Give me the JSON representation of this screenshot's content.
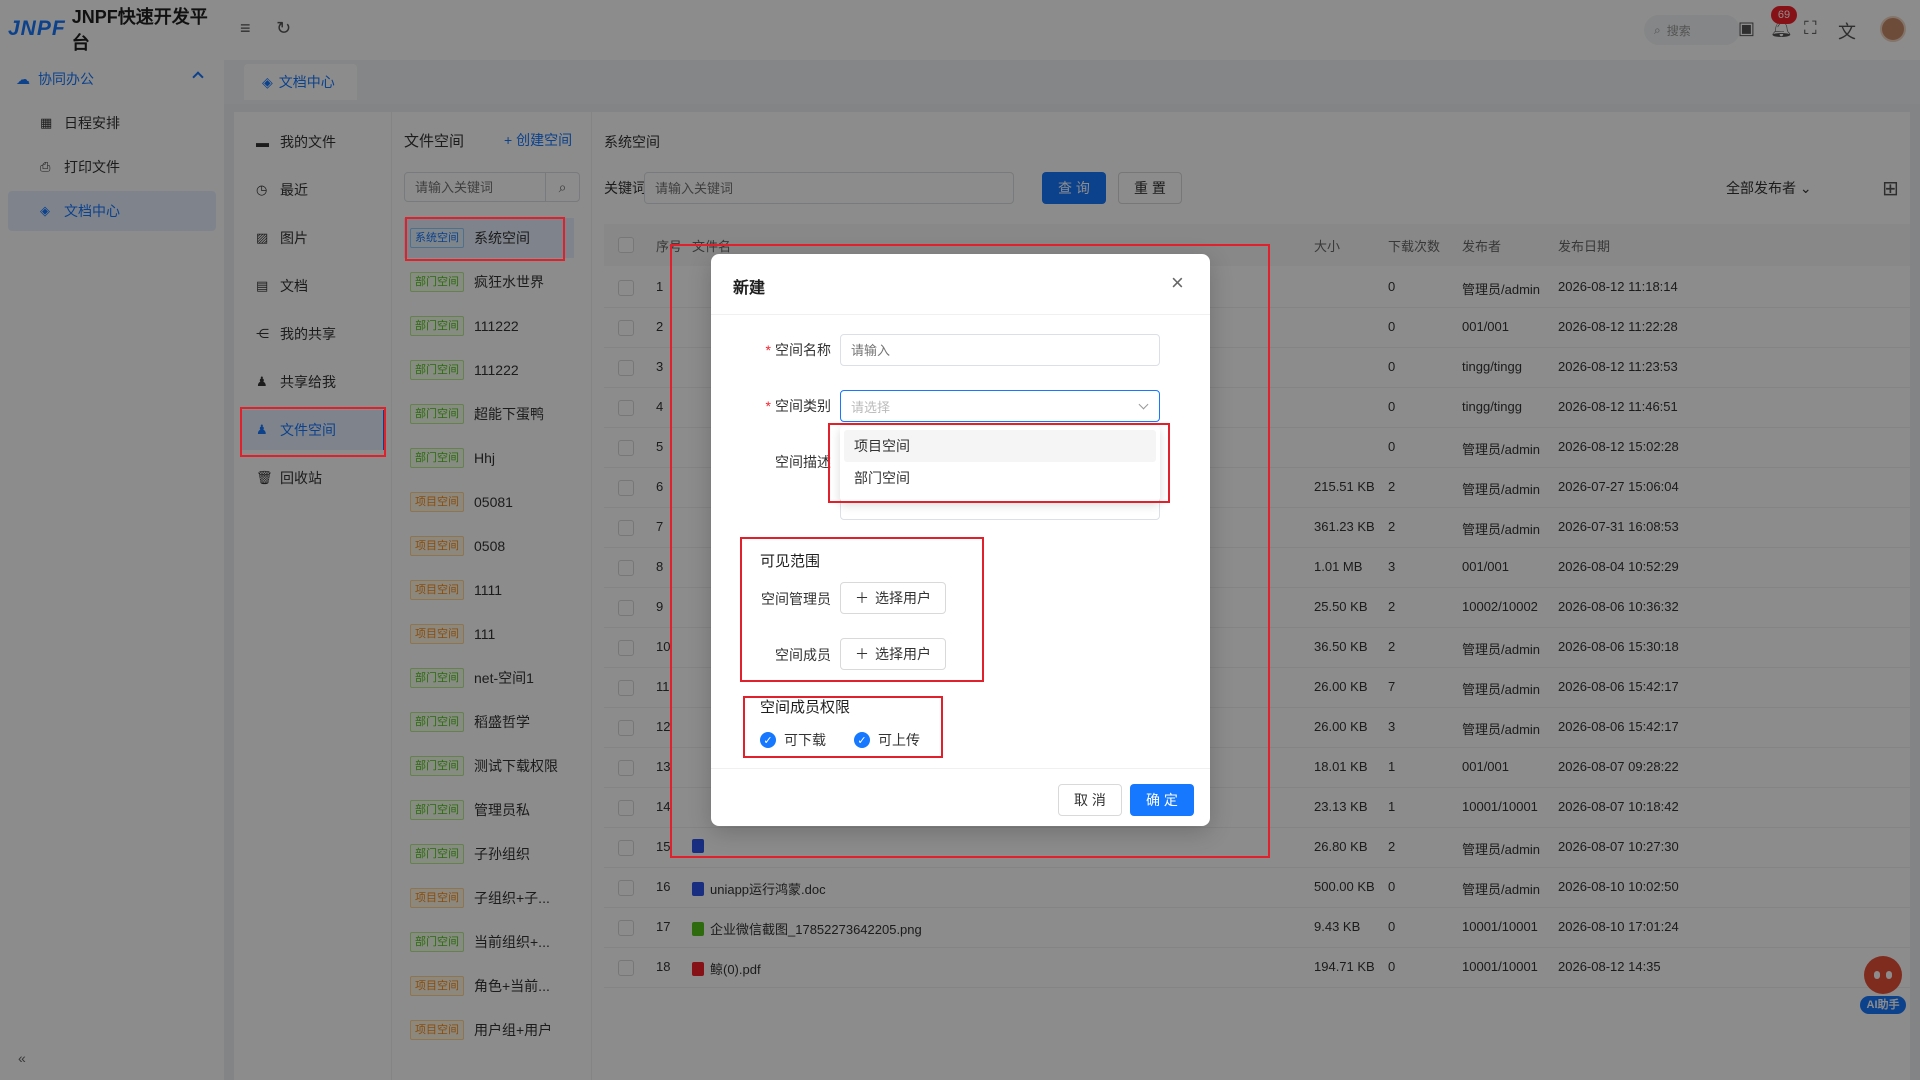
{
  "app": {
    "logo_mark": "JNPF",
    "title": "JNPF快速开发平台"
  },
  "nav": {
    "group": "协同办公",
    "items": [
      {
        "label": "日程安排",
        "icon": "calendar-icon"
      },
      {
        "label": "打印文件",
        "icon": "printer-icon"
      },
      {
        "label": "文档中心",
        "icon": "layers-icon",
        "active": true
      }
    ]
  },
  "topbar": {
    "search_label": "搜索",
    "notification_count": "69"
  },
  "tabs": [
    {
      "label": "文档中心"
    }
  ],
  "file_menu": [
    {
      "label": "我的文件",
      "icon": "folder-icon"
    },
    {
      "label": "最近",
      "icon": "clock-icon"
    },
    {
      "label": "图片",
      "icon": "image-icon"
    },
    {
      "label": "文档",
      "icon": "document-icon"
    },
    {
      "label": "我的共享",
      "icon": "share-icon"
    },
    {
      "label": "共享给我",
      "icon": "users-icon"
    },
    {
      "label": "文件空间",
      "icon": "user-space-icon",
      "active": true
    },
    {
      "label": "回收站",
      "icon": "trash-icon"
    }
  ],
  "spaces": {
    "title": "文件空间",
    "create_label": "+ 创建空间",
    "search_placeholder": "请输入关键词",
    "items": [
      {
        "tag": "系统空间",
        "type": "sys",
        "name": "系统空间"
      },
      {
        "tag": "部门空间",
        "type": "dep",
        "name": "疯狂水世界"
      },
      {
        "tag": "部门空间",
        "type": "dep",
        "name": "111222"
      },
      {
        "tag": "部门空间",
        "type": "dep",
        "name": "111222"
      },
      {
        "tag": "部门空间",
        "type": "dep",
        "name": "超能下蛋鸭"
      },
      {
        "tag": "部门空间",
        "type": "dep",
        "name": "Hhj"
      },
      {
        "tag": "项目空间",
        "type": "proj",
        "name": "05081"
      },
      {
        "tag": "项目空间",
        "type": "proj",
        "name": "0508"
      },
      {
        "tag": "项目空间",
        "type": "proj",
        "name": "1111"
      },
      {
        "tag": "项目空间",
        "type": "proj",
        "name": "111"
      },
      {
        "tag": "部门空间",
        "type": "dep",
        "name": "net-空间1"
      },
      {
        "tag": "部门空间",
        "type": "dep",
        "name": "稻盛哲学"
      },
      {
        "tag": "部门空间",
        "type": "dep",
        "name": "测试下载权限"
      },
      {
        "tag": "部门空间",
        "type": "dep",
        "name": "管理员私"
      },
      {
        "tag": "部门空间",
        "type": "dep",
        "name": "子孙组织"
      },
      {
        "tag": "项目空间",
        "type": "proj",
        "name": "子组织+子..."
      },
      {
        "tag": "部门空间",
        "type": "dep",
        "name": "当前组织+..."
      },
      {
        "tag": "项目空间",
        "type": "proj",
        "name": "角色+当前..."
      },
      {
        "tag": "项目空间",
        "type": "proj",
        "name": "用户组+用户"
      }
    ]
  },
  "files": {
    "title": "系统空间",
    "keyword_label": "关键词",
    "keyword_placeholder": "请输入关键词",
    "query_label": "查 询",
    "reset_label": "重 置",
    "publisher_filter": "全部发布者",
    "columns": [
      "序号",
      "文件名",
      "大小",
      "下载次数",
      "发布者",
      "发布日期"
    ],
    "rows": [
      {
        "no": "1",
        "name": "",
        "size": "",
        "downloads": "0",
        "publisher": "管理员/admin",
        "date": "2026-08-12 11:18:14"
      },
      {
        "no": "2",
        "name": "",
        "size": "",
        "downloads": "0",
        "publisher": "001/001",
        "date": "2026-08-12 11:22:28"
      },
      {
        "no": "3",
        "name": "",
        "size": "",
        "downloads": "0",
        "publisher": "tingg/tingg",
        "date": "2026-08-12 11:23:53"
      },
      {
        "no": "4",
        "name": "",
        "size": "",
        "downloads": "0",
        "publisher": "tingg/tingg",
        "date": "2026-08-12 11:46:51"
      },
      {
        "no": "5",
        "name": "",
        "size": "",
        "downloads": "0",
        "publisher": "管理员/admin",
        "date": "2026-08-12 15:02:28"
      },
      {
        "no": "6",
        "name": "",
        "size": "215.51 KB",
        "downloads": "2",
        "publisher": "管理员/admin",
        "date": "2026-07-27 15:06:04"
      },
      {
        "no": "7",
        "name": "",
        "size": "361.23 KB",
        "downloads": "2",
        "publisher": "管理员/admin",
        "date": "2026-07-31 16:08:53"
      },
      {
        "no": "8",
        "name": "",
        "size": "1.01 MB",
        "downloads": "3",
        "publisher": "001/001",
        "date": "2026-08-04 10:52:29"
      },
      {
        "no": "9",
        "name": "",
        "size": "25.50 KB",
        "downloads": "2",
        "publisher": "10002/10002",
        "date": "2026-08-06 10:36:32"
      },
      {
        "no": "10",
        "name": "",
        "size": "36.50 KB",
        "downloads": "2",
        "publisher": "管理员/admin",
        "date": "2026-08-06 15:30:18"
      },
      {
        "no": "11",
        "name": "",
        "size": "26.00 KB",
        "downloads": "7",
        "publisher": "管理员/admin",
        "date": "2026-08-06 15:42:17"
      },
      {
        "no": "12",
        "name": "",
        "size": "26.00 KB",
        "downloads": "3",
        "publisher": "管理员/admin",
        "date": "2026-08-06 15:42:17"
      },
      {
        "no": "13",
        "name": "",
        "size": "18.01 KB",
        "downloads": "1",
        "publisher": "001/001",
        "date": "2026-08-07 09:28:22"
      },
      {
        "no": "14",
        "name": "",
        "size": "23.13 KB",
        "downloads": "1",
        "publisher": "10001/10001",
        "date": "2026-08-07 10:18:42"
      },
      {
        "no": "15",
        "name": "",
        "size": "26.80 KB",
        "downloads": "2",
        "publisher": "管理员/admin",
        "date": "2026-08-07 10:27:30",
        "file_color": "#2f54eb"
      },
      {
        "no": "16",
        "name": "uniapp运行鸿蒙.doc",
        "size": "500.00 KB",
        "downloads": "0",
        "publisher": "管理员/admin",
        "date": "2026-08-10 10:02:50",
        "file_color": "#2f54eb"
      },
      {
        "no": "17",
        "name": "企业微信截图_17852273642205.png",
        "size": "9.43 KB",
        "downloads": "0",
        "publisher": "10001/10001",
        "date": "2026-08-10 17:01:24",
        "file_color": "#52c41a"
      },
      {
        "no": "18",
        "name": "鲸(0).pdf",
        "size": "194.71 KB",
        "downloads": "0",
        "publisher": "10001/10001",
        "date": "2026-08-12 14:35",
        "file_color": "#f5222d"
      }
    ]
  },
  "modal": {
    "title": "新建",
    "space_name_label": "空间名称",
    "space_name_placeholder": "请输入",
    "space_type_label": "空间类别",
    "space_type_placeholder": "请选择",
    "type_options": [
      "项目空间",
      "部门空间"
    ],
    "space_desc_label": "空间描述",
    "visibility_title": "可见范围",
    "admin_label": "空间管理员",
    "member_label": "空间成员",
    "select_user_label": "选择用户",
    "permission_title": "空间成员权限",
    "perm_download": "可下载",
    "perm_upload": "可上传",
    "cancel_label": "取 消",
    "confirm_label": "确 定"
  },
  "ai": {
    "label": "AI助手"
  },
  "colors": {
    "primary": "#1677ff",
    "annotation": "#e0202b",
    "overlay": "rgba(0,0,0,0.45)"
  }
}
